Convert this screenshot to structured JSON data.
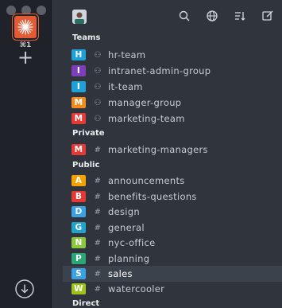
{
  "rail": {
    "server_shortcut": "⌘1",
    "add_symbol": "+"
  },
  "header": {
    "icons": [
      "search-icon",
      "globe-icon",
      "sort-icon",
      "edit-icon"
    ]
  },
  "sections": {
    "teams": {
      "title": "Teams",
      "items": [
        {
          "letter": "H",
          "color": "#1fa1d8",
          "label": "hr-team"
        },
        {
          "letter": "I",
          "color": "#7c3fb8",
          "label": "intranet-admin-group"
        },
        {
          "letter": "I",
          "color": "#1fa1d8",
          "label": "it-team"
        },
        {
          "letter": "M",
          "color": "#f38c1f",
          "label": "manager-group"
        },
        {
          "letter": "M",
          "color": "#e53935",
          "label": "marketing-team"
        }
      ]
    },
    "private": {
      "title": "Private",
      "items": [
        {
          "letter": "M",
          "color": "#e53935",
          "label": "marketing-managers"
        }
      ]
    },
    "public": {
      "title": "Public",
      "items": [
        {
          "letter": "A",
          "color": "#f5a200",
          "label": "announcements"
        },
        {
          "letter": "B",
          "color": "#e53935",
          "label": "benefits-questions"
        },
        {
          "letter": "D",
          "color": "#3aa2e2",
          "label": "design"
        },
        {
          "letter": "G",
          "color": "#22a3c9",
          "label": "general"
        },
        {
          "letter": "N",
          "color": "#8cc63f",
          "label": "nyc-office"
        },
        {
          "letter": "P",
          "color": "#2aa774",
          "label": "planning"
        },
        {
          "letter": "S",
          "color": "#3aa2e2",
          "label": "sales"
        },
        {
          "letter": "W",
          "color": "#9bc31c",
          "label": "watercooler"
        }
      ]
    },
    "direct": {
      "title": "Direct"
    }
  }
}
